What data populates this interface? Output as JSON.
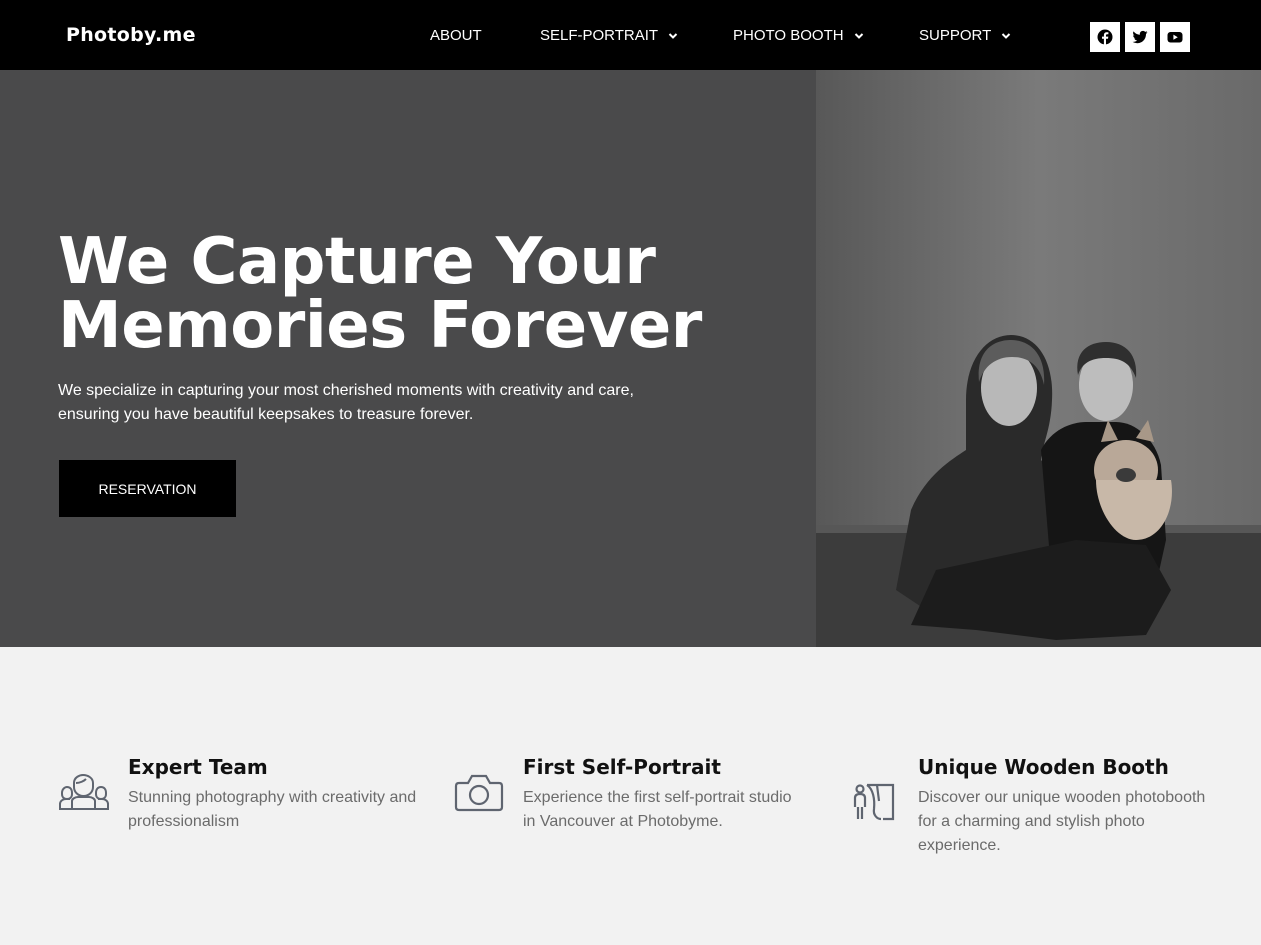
{
  "nav": {
    "logo": "Photoby.me",
    "items": [
      {
        "label": "ABOUT",
        "has_dropdown": false
      },
      {
        "label": "SELF-PORTRAIT",
        "has_dropdown": true
      },
      {
        "label": "PHOTO BOOTH",
        "has_dropdown": true
      },
      {
        "label": "SUPPORT",
        "has_dropdown": true
      }
    ],
    "social": [
      "facebook-icon",
      "twitter-icon",
      "youtube-icon"
    ]
  },
  "hero": {
    "title_line1": "We Capture Your",
    "title_line2": "Memories Forever",
    "subtitle": "We specialize in capturing your most cherished moments with creativity and care, ensuring you have beautiful keepsakes to treasure forever.",
    "button": "RESERVATION"
  },
  "features": [
    {
      "icon": "team-icon",
      "title": "Expert Team",
      "text": "Stunning photography with creativity and professionalism"
    },
    {
      "icon": "camera-icon",
      "title": "First Self-Portrait",
      "text": "Experience the first self-portrait studio in Vancouver at Photobyme."
    },
    {
      "icon": "booth-icon",
      "title": "Unique Wooden Booth",
      "text": "Discover our unique wooden photobooth for a charming and stylish photo experience."
    }
  ],
  "colors": {
    "nav_bg": "#000000",
    "hero_bg": "#4a4a4b",
    "page_bg": "#f2f2f2",
    "button_bg": "#000000",
    "icon_color": "#5f6570"
  }
}
